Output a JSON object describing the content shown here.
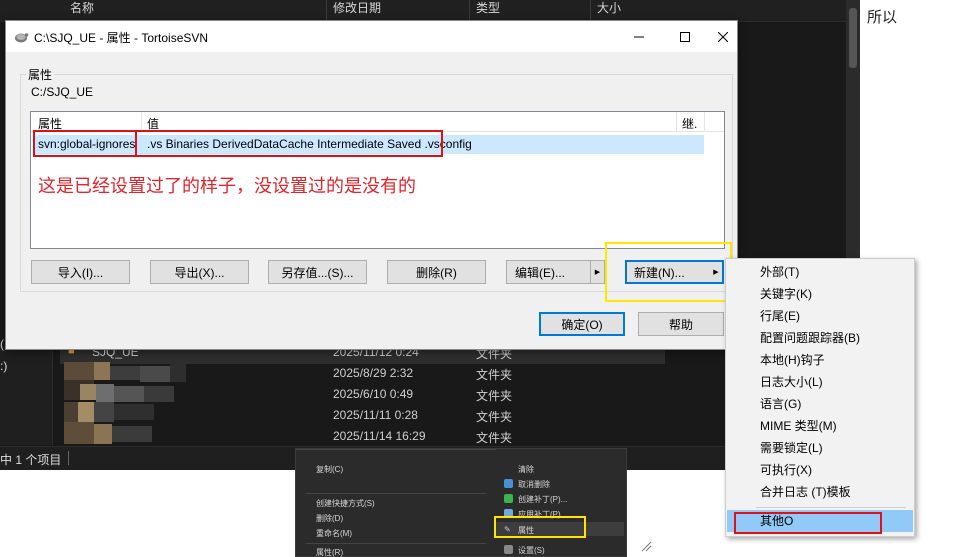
{
  "explorer": {
    "columns": [
      "名称",
      "修改日期",
      "类型",
      "大小"
    ],
    "left_pane": [
      "(",
      ":)"
    ],
    "rows": [
      {
        "name": "SJQ_UE",
        "date": "2025/11/12 0:24",
        "type": "文件夹"
      },
      {
        "name": "",
        "date": "2025/8/29 2:32",
        "type": "文件夹"
      },
      {
        "name": "",
        "date": "2025/6/10 0:49",
        "type": "文件夹"
      },
      {
        "name": "",
        "date": "2025/11/11 0:28",
        "type": "文件夹"
      },
      {
        "name": "",
        "date": "2025/11/14 16:29",
        "type": "文件夹"
      }
    ],
    "status": "中 1 个项目"
  },
  "side_text": "所以",
  "context_menu": {
    "left_items": [
      "复制(C)",
      "创建快捷方式(S)",
      "删除(D)",
      "重命名(M)",
      "属性(R)"
    ],
    "right_items": [
      "取消删除",
      "创建补丁(P)...",
      "应用补丁(P)...",
      "属性",
      "设置(S)"
    ],
    "right_top_item": "清除"
  },
  "dialog": {
    "title": "C:\\SJQ_UE - 属性 - TortoiseSVN",
    "group_label": "属性",
    "path": "C:/SJQ_UE",
    "list": {
      "headers": [
        "属性",
        "值",
        "继."
      ],
      "rows": [
        {
          "property": "svn:global-ignores",
          "value": ".vs Binaries DerivedDataCache Intermediate Saved .vsconfig"
        }
      ]
    },
    "annotation": "这是已经设置过了的样子，没设置过的是没有的",
    "buttons": {
      "import": "导入(I)...",
      "export": "导出(X)...",
      "save_as": "另存值...(S)...",
      "delete": "删除(R)",
      "edit": "编辑(E)...",
      "new": "新建(N)...",
      "ok": "确定(O)",
      "help": "帮助"
    }
  },
  "new_menu": {
    "items": [
      "外部(T)",
      "关键字(K)",
      "行尾(E)",
      "配置问题跟踪器(B)",
      "本地(H)钩子",
      "日志大小(L)",
      "语言(G)",
      "MIME 类型(M)",
      "需要锁定(L)",
      "可执行(X)",
      "合并日志 (T)模板"
    ],
    "other": "其他O"
  },
  "colors": {
    "annotation_red": "#e3242b",
    "highlight_yellow": "#ffe500",
    "selection_blue": "#cce8ff",
    "menu_active": "#91c9f7"
  }
}
